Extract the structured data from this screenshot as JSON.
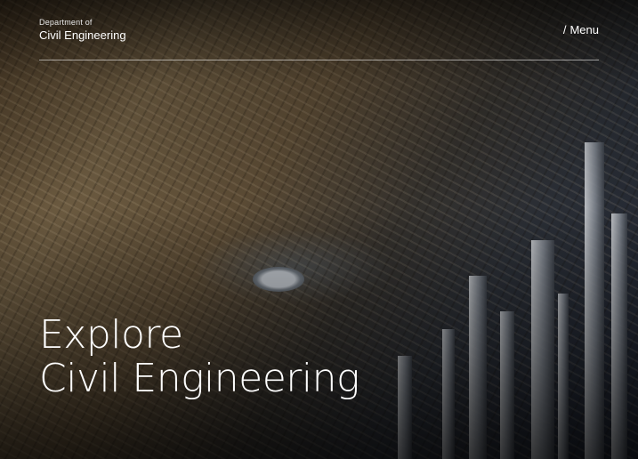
{
  "header": {
    "department_label": "Department of",
    "department_name": "Civil Engineering",
    "menu_slash": "/",
    "menu_label": "Menu"
  },
  "hero": {
    "headline_line1": "Explore",
    "headline_line2": "Civil Engineering",
    "background_icon": "aerial-city-photo"
  },
  "colors": {
    "text": "#ffffff",
    "divider": "#ffffff"
  }
}
